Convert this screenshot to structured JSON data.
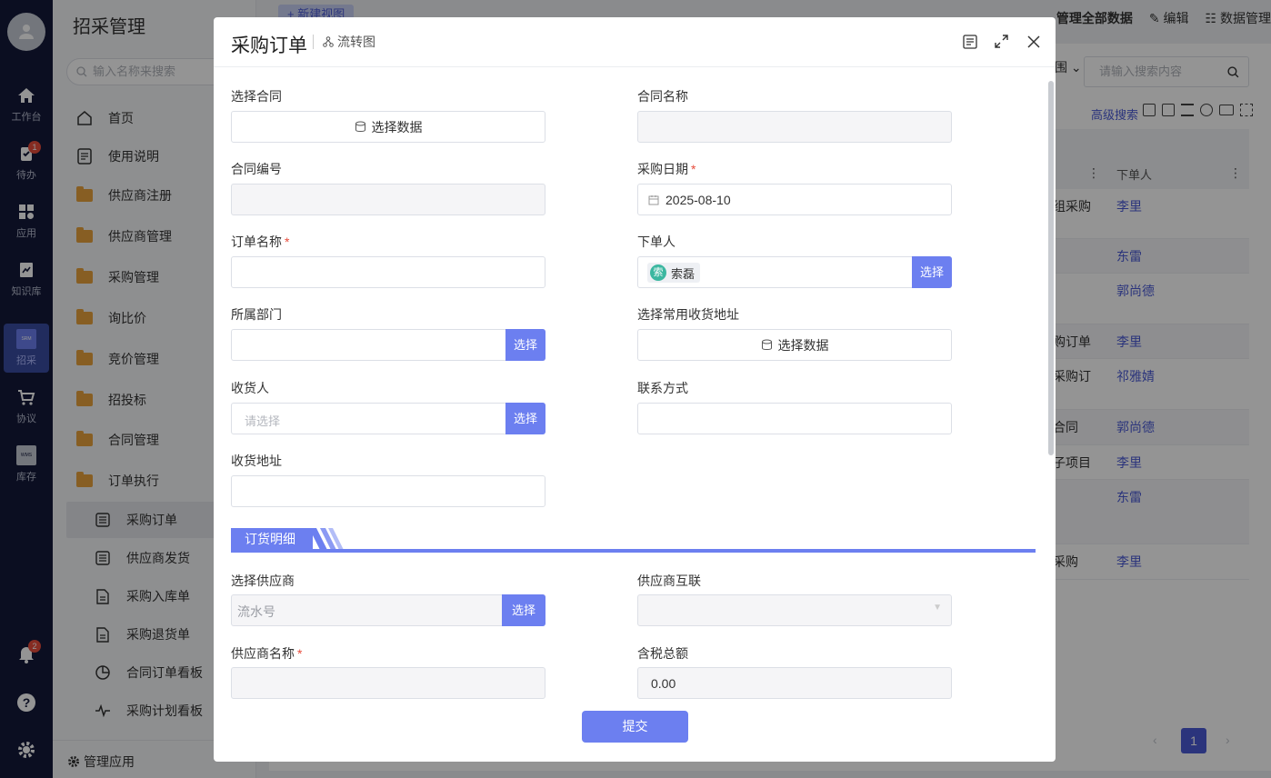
{
  "rail": {
    "items": [
      {
        "label": "工作台"
      },
      {
        "label": "待办",
        "badge": "1"
      },
      {
        "label": "应用"
      },
      {
        "label": "知识库"
      },
      {
        "label": "招采",
        "icon_text": "SRM"
      },
      {
        "label": "协议"
      },
      {
        "label": "库存",
        "icon_text": "WMS"
      }
    ],
    "notify_badge": "2"
  },
  "sidebar": {
    "title": "招采管理",
    "search_placeholder": "输入名称来搜索",
    "items": [
      {
        "label": "首页"
      },
      {
        "label": "使用说明"
      },
      {
        "label": "供应商注册"
      },
      {
        "label": "供应商管理"
      },
      {
        "label": "采购管理"
      },
      {
        "label": "询比价"
      },
      {
        "label": "竞价管理"
      },
      {
        "label": "招投标"
      },
      {
        "label": "合同管理"
      },
      {
        "label": "订单执行"
      },
      {
        "label": "采购订单"
      },
      {
        "label": "供应商发货"
      },
      {
        "label": "采购入库单"
      },
      {
        "label": "采购退货单"
      },
      {
        "label": "合同订单看板"
      },
      {
        "label": "采购计划看板"
      }
    ],
    "manage_label": "管理应用"
  },
  "background": {
    "new_view": "+ 新建视图",
    "manage_all": "管理全部数据",
    "edit": "编辑",
    "data_manage": "数据管理",
    "filter_scope": "围",
    "search_placeholder": "请输入搜索内容",
    "advanced_search": "高级搜索",
    "col_orderer": "下单人",
    "rows": [
      {
        "c1": "组采购",
        "c2": "李里"
      },
      {
        "c1": "",
        "c2": "东雷"
      },
      {
        "c1": "",
        "c2": "郭尚德"
      },
      {
        "c1": "购订单",
        "c2": "李里"
      },
      {
        "c1": "采购订",
        "c2": "祁雅婧"
      },
      {
        "c1": "合同",
        "c2": "郭尚德"
      },
      {
        "c1": "子项目",
        "c2": "李里"
      },
      {
        "c1": "",
        "c2": "东雷"
      },
      {
        "c1": "采购",
        "c2": "李里"
      }
    ],
    "page": "1"
  },
  "modal": {
    "title": "采购订单",
    "flow_label": "流转图",
    "fields": {
      "select_contract": {
        "label": "选择合同",
        "button": "选择数据"
      },
      "contract_name": {
        "label": "合同名称",
        "value": ""
      },
      "contract_no": {
        "label": "合同编号",
        "value": ""
      },
      "purchase_date": {
        "label": "采购日期",
        "value": "2025-08-10"
      },
      "order_name": {
        "label": "订单名称",
        "value": ""
      },
      "orderer": {
        "label": "下单人",
        "tag_avatar": "索",
        "tag_name": "索磊",
        "button": "选择"
      },
      "department": {
        "label": "所属部门",
        "button": "选择"
      },
      "common_address": {
        "label": "选择常用收货地址",
        "button": "选择数据"
      },
      "receiver": {
        "label": "收货人",
        "placeholder": "请选择",
        "button": "选择"
      },
      "contact": {
        "label": "联系方式",
        "value": ""
      },
      "address": {
        "label": "收货地址",
        "value": ""
      },
      "supplier_select": {
        "label": "选择供应商",
        "placeholder": "流水号",
        "button": "选择"
      },
      "supplier_link": {
        "label": "供应商互联",
        "value": ""
      },
      "supplier_name": {
        "label": "供应商名称",
        "value": ""
      },
      "tax_total": {
        "label": "含税总额",
        "value": "0.00"
      }
    },
    "section_title": "订货明细",
    "submit": "提交"
  }
}
